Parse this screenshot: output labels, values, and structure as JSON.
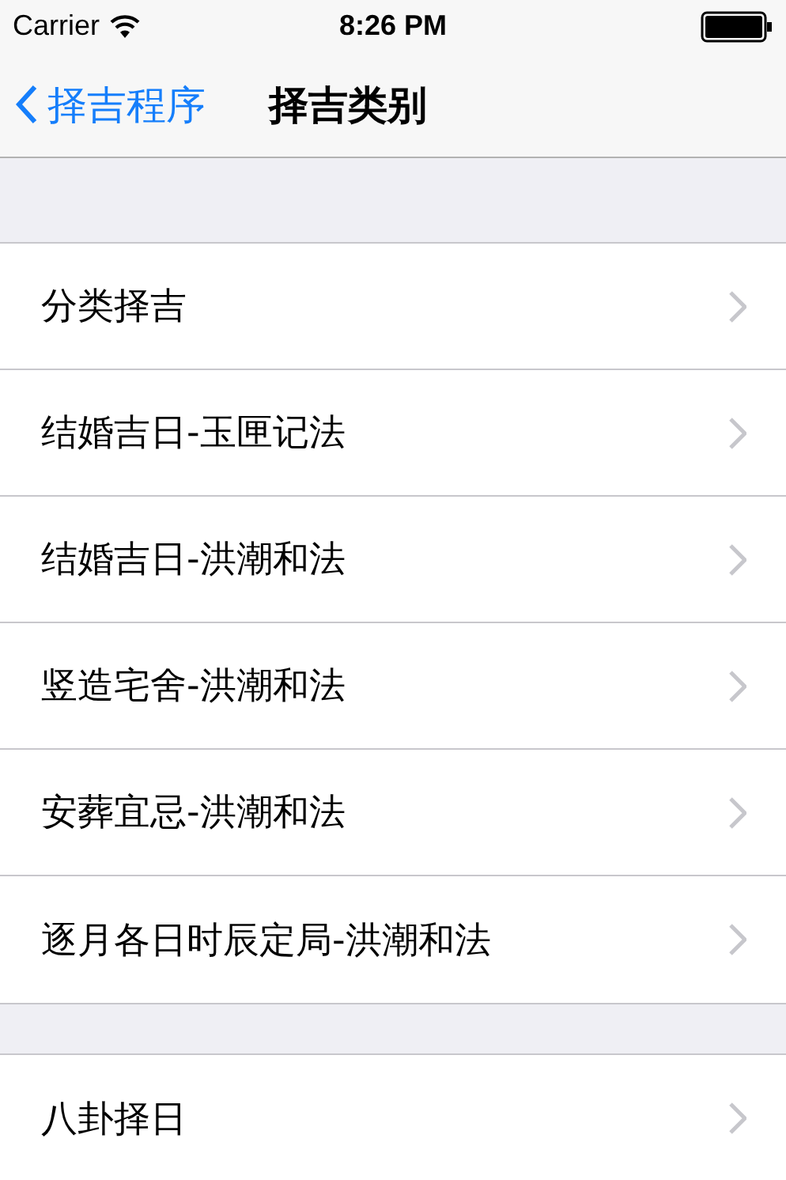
{
  "status_bar": {
    "carrier": "Carrier",
    "time": "8:26 PM"
  },
  "nav_bar": {
    "back": "择吉程序",
    "title": "择吉类别"
  },
  "sections": [
    {
      "rows": [
        {
          "label": "分类择吉"
        },
        {
          "label": "结婚吉日-玉匣记法"
        },
        {
          "label": "结婚吉日-洪潮和法"
        },
        {
          "label": "竖造宅舍-洪潮和法"
        },
        {
          "label": "安葬宜忌-洪潮和法"
        },
        {
          "label": "逐月各日时辰定局-洪潮和法"
        }
      ]
    },
    {
      "rows": [
        {
          "label": "八卦择日"
        }
      ]
    }
  ]
}
